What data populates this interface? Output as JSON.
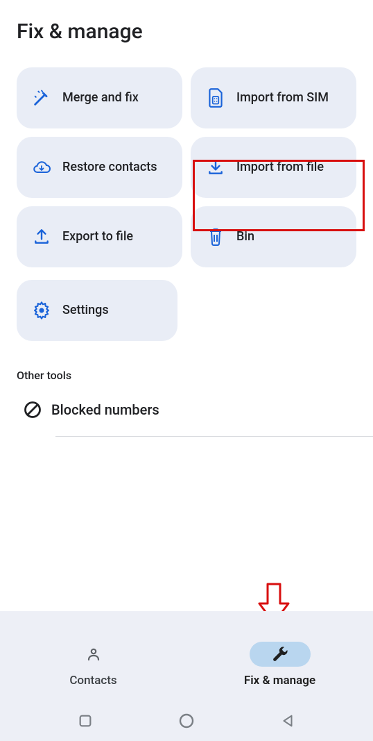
{
  "header": {
    "title": "Fix & manage"
  },
  "tiles": {
    "merge": "Merge and fix",
    "import_sim": "Import from SIM",
    "restore": "Restore contacts",
    "import_file": "Import from file",
    "export": "Export to file",
    "bin": "Bin",
    "settings": "Settings"
  },
  "section": {
    "other_tools": "Other tools"
  },
  "tools": {
    "blocked": "Blocked numbers"
  },
  "nav": {
    "contacts": "Contacts",
    "fix_manage": "Fix & manage"
  },
  "colors": {
    "tile_bg": "#e9edf6",
    "accent": "#1a63d9",
    "highlight": "#d80f0f",
    "pill_active": "#b9d6ef"
  }
}
